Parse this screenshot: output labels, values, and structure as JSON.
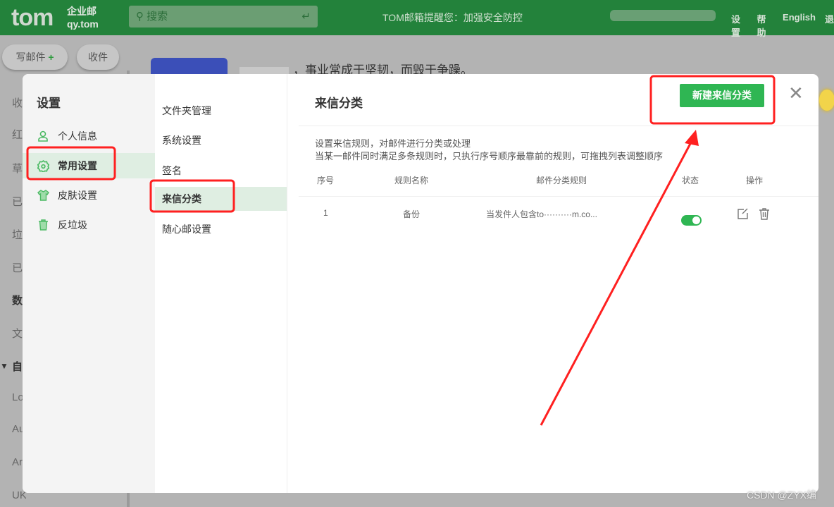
{
  "header": {
    "logo": "tom",
    "logo_sub_1": "企业邮",
    "logo_sub_2": "qy.tom",
    "search_placeholder": "搜索",
    "notice": "TOM邮箱提醒您：加强安全防控",
    "links": [
      "设置",
      "帮助",
      "English",
      "退"
    ]
  },
  "background": {
    "compose_label": "写邮件",
    "inbox_label": "收件",
    "motto": "，事业常成于坚韧，而毁于争躁。",
    "sidebar_letters": [
      "收",
      "红",
      "草",
      "已",
      "垃",
      "已",
      "数",
      "文",
      "自",
      "Lo",
      "Au",
      "Ar",
      "UK"
    ]
  },
  "modal": {
    "title": "设置",
    "nav": [
      {
        "label": "个人信息",
        "icon": "user-icon"
      },
      {
        "label": "常用设置",
        "icon": "gear-icon",
        "active": true
      },
      {
        "label": "皮肤设置",
        "icon": "shirt-icon"
      },
      {
        "label": "反垃圾",
        "icon": "trash-icon"
      }
    ],
    "subnav": [
      {
        "label": "文件夹管理"
      },
      {
        "label": "系统设置"
      },
      {
        "label": "签名"
      },
      {
        "label": "来信分类",
        "active": true
      },
      {
        "label": "随心邮设置"
      }
    ],
    "content": {
      "title": "来信分类",
      "new_button": "新建来信分类",
      "desc_1": "设置来信规则，对邮件进行分类或处理",
      "desc_2": "当某一邮件同时满足多条规则时，只执行序号顺序最靠前的规则，可拖拽列表调整顺序",
      "columns": [
        "序号",
        "规则名称",
        "邮件分类规则",
        "状态",
        "操作"
      ],
      "rows": [
        {
          "index": "1",
          "name": "备份",
          "rule": "当发件人包含to··········m.co...",
          "enabled": true
        }
      ]
    }
  },
  "watermark": "CSDN @ZYX编",
  "colors": {
    "header": "#23823b",
    "accent": "#2fb653",
    "annotation": "#ff2020"
  }
}
